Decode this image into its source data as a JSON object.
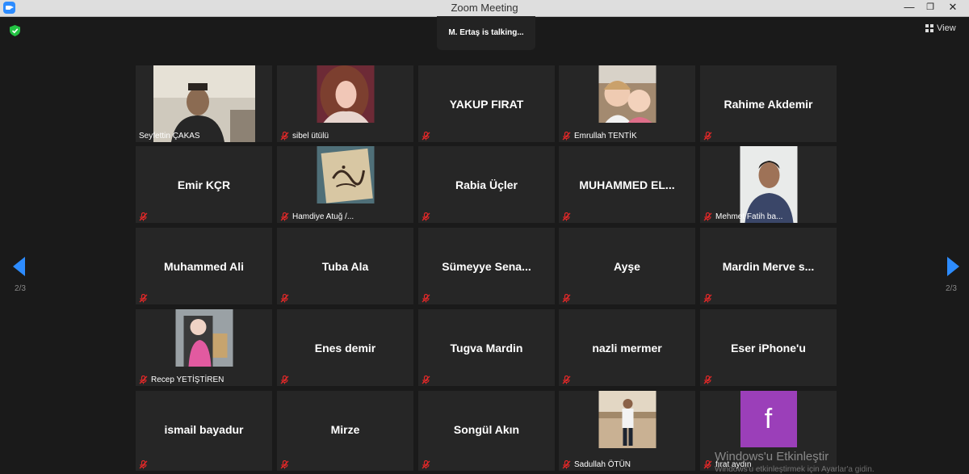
{
  "window": {
    "title": "Zoom Meeting"
  },
  "status": {
    "talking": "M. Ertaş is talking..."
  },
  "toolbar": {
    "view_label": "View"
  },
  "pagination": {
    "page": "2/3"
  },
  "colors": {
    "accent": "#2d8cff",
    "mute": "#e02828",
    "shield": "#23c343",
    "avatar_f": "#9b3fb9"
  },
  "tiles": [
    {
      "name": "",
      "label": "Seyfettin ÇAKAS",
      "muted": false,
      "photo": "wide-man"
    },
    {
      "name": "",
      "label": "sibel ütülü",
      "muted": true,
      "photo": "woman"
    },
    {
      "name": "YAKUP FIRAT",
      "label": "",
      "muted": true,
      "photo": ""
    },
    {
      "name": "",
      "label": "Emrullah TENTİK",
      "muted": true,
      "photo": "children"
    },
    {
      "name": "Rahime Akdemir",
      "label": "",
      "muted": true,
      "photo": ""
    },
    {
      "name": "Emir KÇR",
      "label": "",
      "muted": true,
      "photo": ""
    },
    {
      "name": "",
      "label": "Hamdiye Atuğ /...",
      "muted": true,
      "photo": "calligraphy"
    },
    {
      "name": "Rabia Üçler",
      "label": "",
      "muted": true,
      "photo": ""
    },
    {
      "name": "MUHAMMED  EL...",
      "label": "",
      "muted": true,
      "photo": ""
    },
    {
      "name": "",
      "label": "Mehmet Fatih ba...",
      "muted": true,
      "photo": "man-portrait"
    },
    {
      "name": "Muhammed Ali",
      "label": "",
      "muted": true,
      "photo": ""
    },
    {
      "name": "Tuba Ala",
      "label": "",
      "muted": true,
      "photo": ""
    },
    {
      "name": "Sümeyye  Sena...",
      "label": "",
      "muted": true,
      "photo": ""
    },
    {
      "name": "Ayşe",
      "label": "",
      "muted": true,
      "photo": ""
    },
    {
      "name": "Mardin  Merve s...",
      "label": "",
      "muted": true,
      "photo": ""
    },
    {
      "name": "",
      "label": "Recep YETİŞTİREN",
      "muted": true,
      "photo": "child-pink"
    },
    {
      "name": "Enes demir",
      "label": "",
      "muted": true,
      "photo": ""
    },
    {
      "name": "Tugva Mardin",
      "label": "",
      "muted": true,
      "photo": ""
    },
    {
      "name": "nazli mermer",
      "label": "",
      "muted": true,
      "photo": ""
    },
    {
      "name": "Eser iPhone'u",
      "label": "",
      "muted": true,
      "photo": ""
    },
    {
      "name": "ismail bayadur",
      "label": "",
      "muted": true,
      "photo": ""
    },
    {
      "name": "Mirze",
      "label": "",
      "muted": true,
      "photo": ""
    },
    {
      "name": "Songül Akın",
      "label": "",
      "muted": true,
      "photo": ""
    },
    {
      "name": "",
      "label": "Sadullah ÖTÜN",
      "muted": true,
      "photo": "man-outdoor"
    },
    {
      "name": "",
      "label": "fırat aydın",
      "muted": true,
      "photo": "letter-f",
      "avatar_letter": "f"
    }
  ],
  "watermark": {
    "title": "Windows'u Etkinleştir",
    "subtitle": "Windows'u etkinleştirmek için Ayarlar'a gidin."
  }
}
